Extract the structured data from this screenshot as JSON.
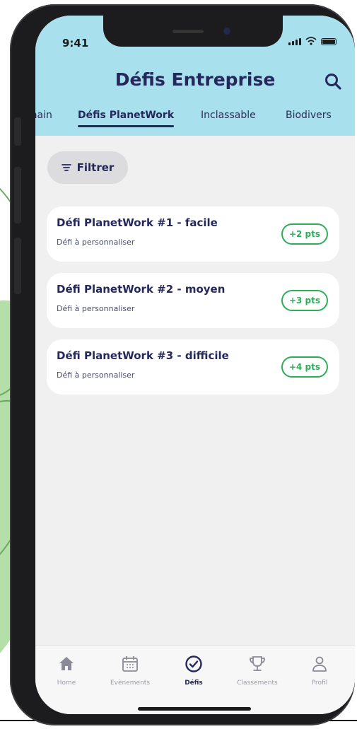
{
  "status_bar": {
    "time": "9:41"
  },
  "header": {
    "title": "Défis Entreprise"
  },
  "tabs": [
    {
      "label": "umain"
    },
    {
      "label": "Défis PlanetWork"
    },
    {
      "label": "Inclassable"
    },
    {
      "label": "Biodivers"
    }
  ],
  "filter": {
    "label": "Filtrer"
  },
  "challenges": [
    {
      "title": "Défi PlanetWork #1 - facile",
      "subtitle": "Défi à personnaliser",
      "points": "+2 pts"
    },
    {
      "title": "Défi PlanetWork #2 - moyen",
      "subtitle": "Défi à personnaliser",
      "points": "+3 pts"
    },
    {
      "title": "Défi PlanetWork #3 - difficile",
      "subtitle": "Défi à personnaliser",
      "points": "+4 pts"
    }
  ],
  "bottom_nav": [
    {
      "label": "Home",
      "icon": "home-icon"
    },
    {
      "label": "Evènements",
      "icon": "calendar-icon"
    },
    {
      "label": "Défis",
      "icon": "check-circle-icon",
      "active": true
    },
    {
      "label": "Classements",
      "icon": "trophy-icon"
    },
    {
      "label": "Profil",
      "icon": "profile-icon"
    }
  ],
  "colors": {
    "header_bg": "#a9e0ee",
    "primary": "#24285b",
    "points_green": "#2fae5a"
  }
}
